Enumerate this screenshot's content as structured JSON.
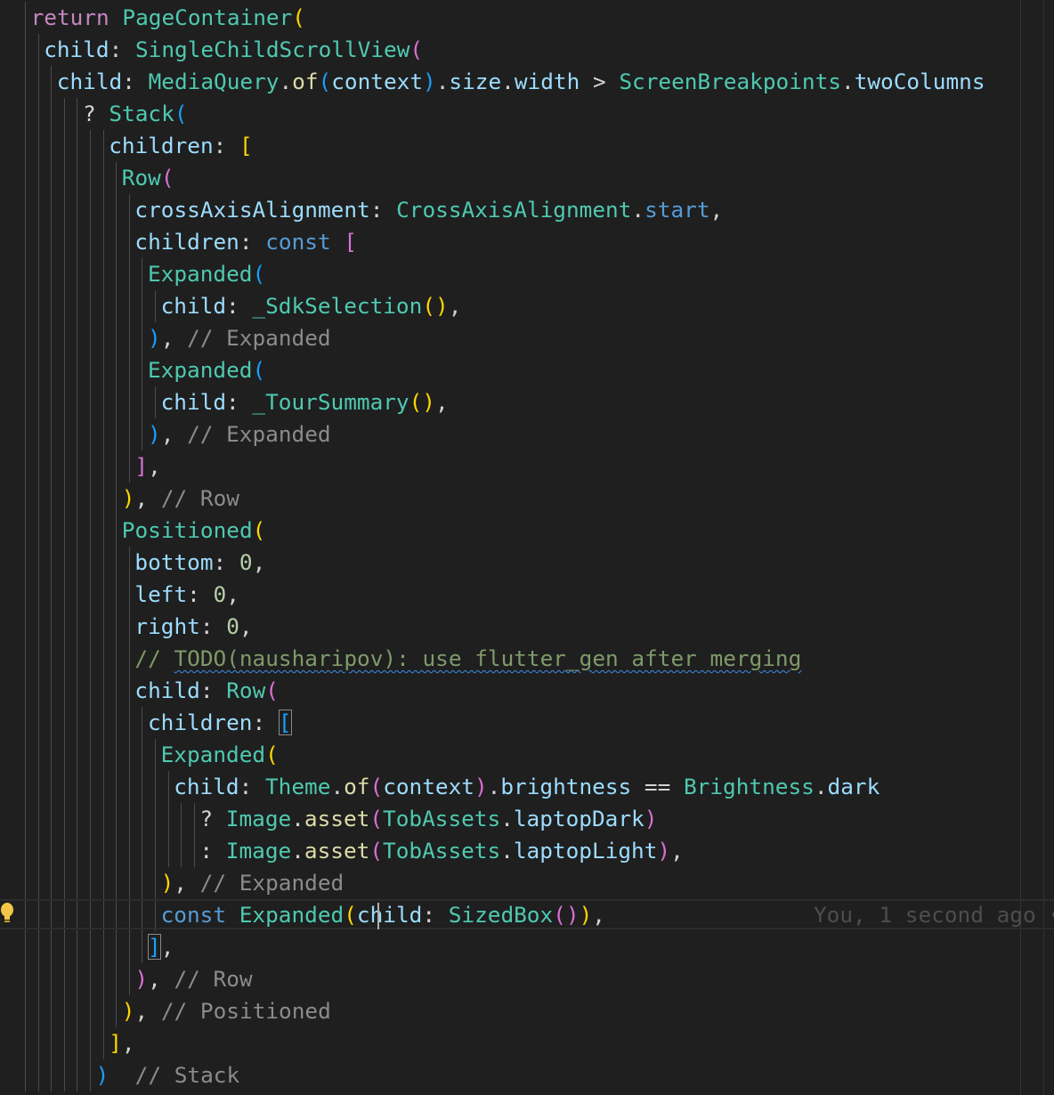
{
  "editor": {
    "lines": [
      [
        {
          "t": "return ",
          "c": "kw"
        },
        {
          "t": "PageContainer",
          "c": "cls"
        },
        {
          "t": "(",
          "c": "b1"
        }
      ],
      [
        {
          "t": "child",
          "c": "prop"
        },
        {
          "t": ": ",
          "c": "op"
        },
        {
          "t": "SingleChildScrollView",
          "c": "cls"
        },
        {
          "t": "(",
          "c": "b2"
        }
      ],
      [
        {
          "t": "child",
          "c": "prop"
        },
        {
          "t": ": ",
          "c": "op"
        },
        {
          "t": "MediaQuery",
          "c": "cls"
        },
        {
          "t": ".",
          "c": "op"
        },
        {
          "t": "of",
          "c": "fn"
        },
        {
          "t": "(",
          "c": "b3"
        },
        {
          "t": "context",
          "c": "prop"
        },
        {
          "t": ")",
          "c": "b3"
        },
        {
          "t": ".",
          "c": "op"
        },
        {
          "t": "size",
          "c": "prop"
        },
        {
          "t": ".",
          "c": "op"
        },
        {
          "t": "width",
          "c": "prop"
        },
        {
          "t": " > ",
          "c": "op"
        },
        {
          "t": "ScreenBreakpoints",
          "c": "cls"
        },
        {
          "t": ".",
          "c": "op"
        },
        {
          "t": "twoColumns",
          "c": "prop"
        }
      ],
      [
        {
          "t": "? ",
          "c": "op"
        },
        {
          "t": "Stack",
          "c": "cls"
        },
        {
          "t": "(",
          "c": "b3"
        }
      ],
      [
        {
          "t": "children",
          "c": "prop"
        },
        {
          "t": ": ",
          "c": "op"
        },
        {
          "t": "[",
          "c": "b1"
        }
      ],
      [
        {
          "t": "Row",
          "c": "cls"
        },
        {
          "t": "(",
          "c": "b2"
        }
      ],
      [
        {
          "t": "crossAxisAlignment",
          "c": "prop"
        },
        {
          "t": ": ",
          "c": "op"
        },
        {
          "t": "CrossAxisAlignment",
          "c": "cls"
        },
        {
          "t": ".",
          "c": "op"
        },
        {
          "t": "start",
          "c": "kw2"
        },
        {
          "t": ",",
          "c": "op"
        }
      ],
      [
        {
          "t": "children",
          "c": "prop"
        },
        {
          "t": ": ",
          "c": "op"
        },
        {
          "t": "const",
          "c": "kw2"
        },
        {
          "t": " ",
          "c": "op"
        },
        {
          "t": "[",
          "c": "b2"
        }
      ],
      [
        {
          "t": "Expanded",
          "c": "cls"
        },
        {
          "t": "(",
          "c": "b3"
        }
      ],
      [
        {
          "t": "child",
          "c": "prop"
        },
        {
          "t": ": ",
          "c": "op"
        },
        {
          "t": "_SdkSelection",
          "c": "cls"
        },
        {
          "t": "()",
          "c": "b1"
        },
        {
          "t": ",",
          "c": "op"
        }
      ],
      [
        {
          "t": ")",
          "c": "b3"
        },
        {
          "t": ", ",
          "c": "op"
        },
        {
          "t": "// Expanded",
          "c": "cmt"
        }
      ],
      [
        {
          "t": "Expanded",
          "c": "cls"
        },
        {
          "t": "(",
          "c": "b3"
        }
      ],
      [
        {
          "t": "child",
          "c": "prop"
        },
        {
          "t": ": ",
          "c": "op"
        },
        {
          "t": "_TourSummary",
          "c": "cls"
        },
        {
          "t": "()",
          "c": "b1"
        },
        {
          "t": ",",
          "c": "op"
        }
      ],
      [
        {
          "t": ")",
          "c": "b3"
        },
        {
          "t": ", ",
          "c": "op"
        },
        {
          "t": "// Expanded",
          "c": "cmt"
        }
      ],
      [
        {
          "t": "]",
          "c": "b2"
        },
        {
          "t": ",",
          "c": "op"
        }
      ],
      [
        {
          "t": ")",
          "c": "b1"
        },
        {
          "t": ", ",
          "c": "op"
        },
        {
          "t": "// Row",
          "c": "cmt"
        }
      ],
      [
        {
          "t": "Positioned",
          "c": "cls"
        },
        {
          "t": "(",
          "c": "b1"
        }
      ],
      [
        {
          "t": "bottom",
          "c": "prop"
        },
        {
          "t": ": ",
          "c": "op"
        },
        {
          "t": "0",
          "c": "num"
        },
        {
          "t": ",",
          "c": "op"
        }
      ],
      [
        {
          "t": "left",
          "c": "prop"
        },
        {
          "t": ": ",
          "c": "op"
        },
        {
          "t": "0",
          "c": "num"
        },
        {
          "t": ",",
          "c": "op"
        }
      ],
      [
        {
          "t": "right",
          "c": "prop"
        },
        {
          "t": ": ",
          "c": "op"
        },
        {
          "t": "0",
          "c": "num"
        },
        {
          "t": ",",
          "c": "op"
        }
      ],
      [
        {
          "t": "// ",
          "c": "todo"
        },
        {
          "t": "TODO(nausharipov): use flutter_gen after merging",
          "c": "todo squiggle"
        }
      ],
      [
        {
          "t": "child",
          "c": "prop"
        },
        {
          "t": ": ",
          "c": "op"
        },
        {
          "t": "Row",
          "c": "cls"
        },
        {
          "t": "(",
          "c": "b2"
        }
      ],
      [
        {
          "t": "children",
          "c": "prop"
        },
        {
          "t": ": ",
          "c": "op"
        },
        {
          "t": "[",
          "c": "b3 bracket-match"
        }
      ],
      [
        {
          "t": "Expanded",
          "c": "cls"
        },
        {
          "t": "(",
          "c": "b1"
        }
      ],
      [
        {
          "t": "child",
          "c": "prop"
        },
        {
          "t": ": ",
          "c": "op"
        },
        {
          "t": "Theme",
          "c": "cls"
        },
        {
          "t": ".",
          "c": "op"
        },
        {
          "t": "of",
          "c": "fn"
        },
        {
          "t": "(",
          "c": "b2"
        },
        {
          "t": "context",
          "c": "prop"
        },
        {
          "t": ")",
          "c": "b2"
        },
        {
          "t": ".",
          "c": "op"
        },
        {
          "t": "brightness",
          "c": "prop"
        },
        {
          "t": " == ",
          "c": "op"
        },
        {
          "t": "Brightness",
          "c": "cls"
        },
        {
          "t": ".",
          "c": "op"
        },
        {
          "t": "dark",
          "c": "prop"
        }
      ],
      [
        {
          "t": "? ",
          "c": "op"
        },
        {
          "t": "Image",
          "c": "cls"
        },
        {
          "t": ".",
          "c": "op"
        },
        {
          "t": "asset",
          "c": "fn"
        },
        {
          "t": "(",
          "c": "b2"
        },
        {
          "t": "TobAssets",
          "c": "cls"
        },
        {
          "t": ".",
          "c": "op"
        },
        {
          "t": "laptopDark",
          "c": "prop"
        },
        {
          "t": ")",
          "c": "b2"
        }
      ],
      [
        {
          "t": ": ",
          "c": "op"
        },
        {
          "t": "Image",
          "c": "cls"
        },
        {
          "t": ".",
          "c": "op"
        },
        {
          "t": "asset",
          "c": "fn"
        },
        {
          "t": "(",
          "c": "b2"
        },
        {
          "t": "TobAssets",
          "c": "cls"
        },
        {
          "t": ".",
          "c": "op"
        },
        {
          "t": "laptopLight",
          "c": "prop"
        },
        {
          "t": ")",
          "c": "b2"
        },
        {
          "t": ",",
          "c": "op"
        }
      ],
      [
        {
          "t": ")",
          "c": "b1"
        },
        {
          "t": ", ",
          "c": "op"
        },
        {
          "t": "// Expanded",
          "c": "cmt"
        }
      ],
      [
        {
          "t": "const",
          "c": "kw2"
        },
        {
          "t": " ",
          "c": "op"
        },
        {
          "t": "Expanded",
          "c": "cls"
        },
        {
          "t": "(",
          "c": "b1"
        },
        {
          "t": "child",
          "c": "prop"
        },
        {
          "t": ": ",
          "c": "op"
        },
        {
          "t": "SizedBox",
          "c": "cls"
        },
        {
          "t": "()",
          "c": "b2"
        },
        {
          "t": ")",
          "c": "b1"
        },
        {
          "t": ",",
          "c": "op"
        }
      ],
      [
        {
          "t": "]",
          "c": "b3 bracket-match"
        },
        {
          "t": ",",
          "c": "op"
        }
      ],
      [
        {
          "t": ")",
          "c": "b2"
        },
        {
          "t": ", ",
          "c": "op"
        },
        {
          "t": "// Row",
          "c": "cmt"
        }
      ],
      [
        {
          "t": ")",
          "c": "b1"
        },
        {
          "t": ", ",
          "c": "op"
        },
        {
          "t": "// Positioned",
          "c": "cmt"
        }
      ],
      [
        {
          "t": "]",
          "c": "b1"
        },
        {
          "t": ",",
          "c": "op"
        }
      ],
      [
        {
          "t": ")",
          "c": "b3"
        },
        {
          "t": "  ",
          "c": "op"
        },
        {
          "t": "// Stack",
          "c": "cmt"
        }
      ]
    ],
    "blame": "You, 1 second ago •"
  }
}
